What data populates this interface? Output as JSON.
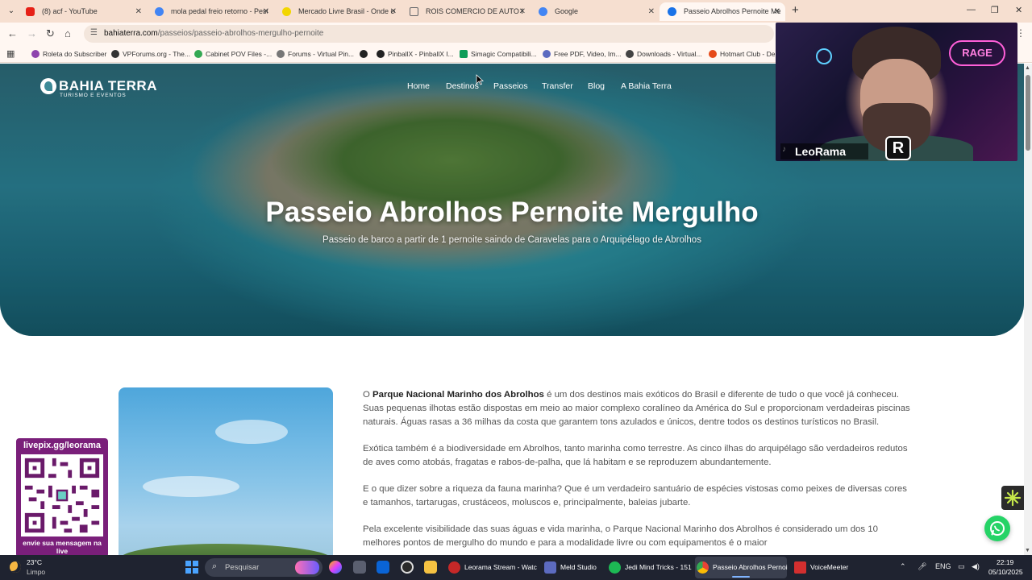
{
  "browser": {
    "tabs": [
      {
        "label": "(8) acf - YouTube",
        "favicon_color": "#e62117"
      },
      {
        "label": "mola pedal freio retorno - Pesq",
        "favicon_color": "#4285f4"
      },
      {
        "label": "Mercado Livre Brasil - Onde co",
        "favicon_color": "#f2d600"
      },
      {
        "label": "ROIS COMERCIO DE AUTO PEÇ",
        "favicon_color": "#5f6368"
      },
      {
        "label": "Google",
        "favicon_color": "#4285f4"
      },
      {
        "label": "Passeio Abrolhos Pernoite Merg",
        "favicon_color": "#1a73e8"
      }
    ],
    "new_tab_icon": "+",
    "address": {
      "host": "bahiaterra.com",
      "path": "/passeios/passeio-abrolhos-mergulho-pernoite"
    },
    "bookmarks": [
      {
        "label": "Roleta do Subscriber",
        "color": "#8e44ad"
      },
      {
        "label": "VPForums.org - The...",
        "color": "#333333"
      },
      {
        "label": "Cabinet POV Files -...",
        "color": "#34a853"
      },
      {
        "label": "Forums - Virtual Pin...",
        "color": "#777777"
      },
      {
        "label": "",
        "color": "#222222"
      },
      {
        "label": "PinballX - PinballX I...",
        "color": "#222222"
      },
      {
        "label": "Simagic Compatibili...",
        "color": "#0f9d58"
      },
      {
        "label": "Free PDF, Video, Im...",
        "color": "#5c6bc0"
      },
      {
        "label": "Downloads - Virtual...",
        "color": "#444444"
      },
      {
        "label": "Hotmart Club - Dell",
        "color": "#e64a19"
      }
    ]
  },
  "site": {
    "logo_name": "BAHIA TERRA",
    "logo_sub": "TURISMO E EVENTOS",
    "nav": [
      "Home",
      "Destinos",
      "Passeios",
      "Transfer",
      "Blog",
      "A Bahia Terra"
    ],
    "hero_title": "Passeio Abrolhos Pernoite Mergulho",
    "hero_subtitle": "Passeio de barco a partir de 1 pernoite saindo de Caravelas para o Arquipélago de Abrolhos",
    "paragraphs": [
      {
        "pre": "O ",
        "strong": "Parque Nacional Marinho dos Abrolhos",
        "post": " é um dos destinos mais exóticos do Brasil e diferente de tudo o que você já conheceu. Suas pequenas ilhotas estão dispostas em meio ao maior complexo coralíneo da América do Sul e proporcionam verdadeiras piscinas naturais. Águas rasas a 36 milhas da costa que garantem tons azulados e únicos, dentre todos os destinos turísticos no Brasil."
      },
      {
        "pre": "Exótica também é a biodiversidade em Abrolhos, tanto marinha como terrestre. As cinco ilhas do arquipélago são verdadeiros redutos de aves como atobás, fragatas e rabos-de-palha, que lá habitam e se reproduzem abundantemente.",
        "strong": "",
        "post": ""
      },
      {
        "pre": "E o que dizer sobre a riqueza da fauna marinha? Que é um verdadeiro santuário de espécies vistosas como peixes de diversas cores e tamanhos, tartarugas, crustáceos, moluscos e, principalmente, baleias jubarte.",
        "strong": "",
        "post": ""
      },
      {
        "pre": "Pela excelente visibilidade das suas águas e vida marinha, o Parque Nacional Marinho dos Abrolhos é considerado um dos 10 melhores pontos de mergulho do mundo e para a modalidade livre ou com equipamentos é o maior",
        "strong": "",
        "post": ""
      }
    ]
  },
  "overlay": {
    "livepix_title": "livepix.gg/leorama",
    "livepix_footer": "envie sua mensagem na live",
    "webcam_name": "LeoRama",
    "webcam_logo": "R",
    "webcam_sign": "RAGE"
  },
  "taskbar": {
    "weather_temp": "23°C",
    "weather_cond": "Limpo",
    "search_placeholder": "Pesquisar",
    "apps": [
      {
        "label": "Leorama Stream - Watc",
        "color": "#c62828"
      },
      {
        "label": "Meld Studio",
        "color": "#5c6bc0"
      },
      {
        "label": "Jedi Mind Tricks - 151",
        "color": "#1db954"
      },
      {
        "label": "Passeio Abrolhos Pernoi",
        "color": "#4285f4"
      },
      {
        "label": "VoiceMeeter",
        "color": "#d32f2f"
      }
    ],
    "lang": "ENG",
    "time": "22:19",
    "date": "05/10/2025"
  }
}
